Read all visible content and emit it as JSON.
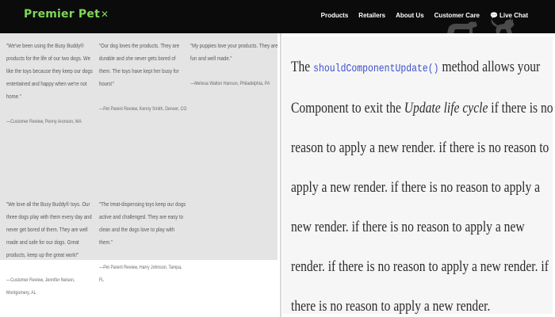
{
  "header": {
    "logo": "Premier Pet",
    "logo_mark": "✕",
    "nav": [
      "Products",
      "Retailers",
      "About Us",
      "Customer Care",
      "Live Chat"
    ],
    "bg_color": "#0b0b0b",
    "brand_color": "#7ed957"
  },
  "testimonials": [
    {
      "text": "\"We've been using the Busy Buddy® products for the life of our two dogs. We like the toys because they keep our dogs entertained and happy when we're not home.\"",
      "author": "—Customer Review, Penny Aronson, MA"
    },
    {
      "text": "\"Our dog loves the products. They are durable and she never gets bored of them. The toys have kept her busy for hours!\"",
      "author": "—Pet Parent Review, Kenny Smith, Denver, CO"
    },
    {
      "text": "\"My puppies love your products. They are fun and well made.\"",
      "author": "—Melissa Walton Hanson, Philadelphia, PA"
    },
    {
      "text": "\"We love all the Busy Buddy® toys. Our three dogs play with them every day and never get bored of them. They are well made and safe for our dogs. Great products, keep up the great work!\"",
      "author": "—Customer Review, Jennifer Nelson, Montgomery, AL"
    },
    {
      "text": "\"The treat-dispensing toys keep our dogs active and challenged. They are easy to clean and the dogs love to play with them.\"",
      "author": "—Pet Parent Review, Harry Johnson, Tampa, FL"
    }
  ],
  "panel": {
    "lead": "The",
    "code": "shouldComponentUpdate()",
    "p1": "method allows your Component to exit the",
    "em": "Update life cycle",
    "p2": "if there is no reason to apply a new render. if there is no reason to apply a new render. if there is no reason to apply a new render. if there is no reason to apply a new render. if there is no reason to apply a new render. if there is no reason to apply a new render."
  },
  "icons": [
    "chat-bubble-icon",
    "pets-silhouette-icon"
  ],
  "colors": {
    "testimonial_bg": "#e4e4e4",
    "panel_bg": "#f6f6f6",
    "code_color": "#3d4fc9"
  }
}
